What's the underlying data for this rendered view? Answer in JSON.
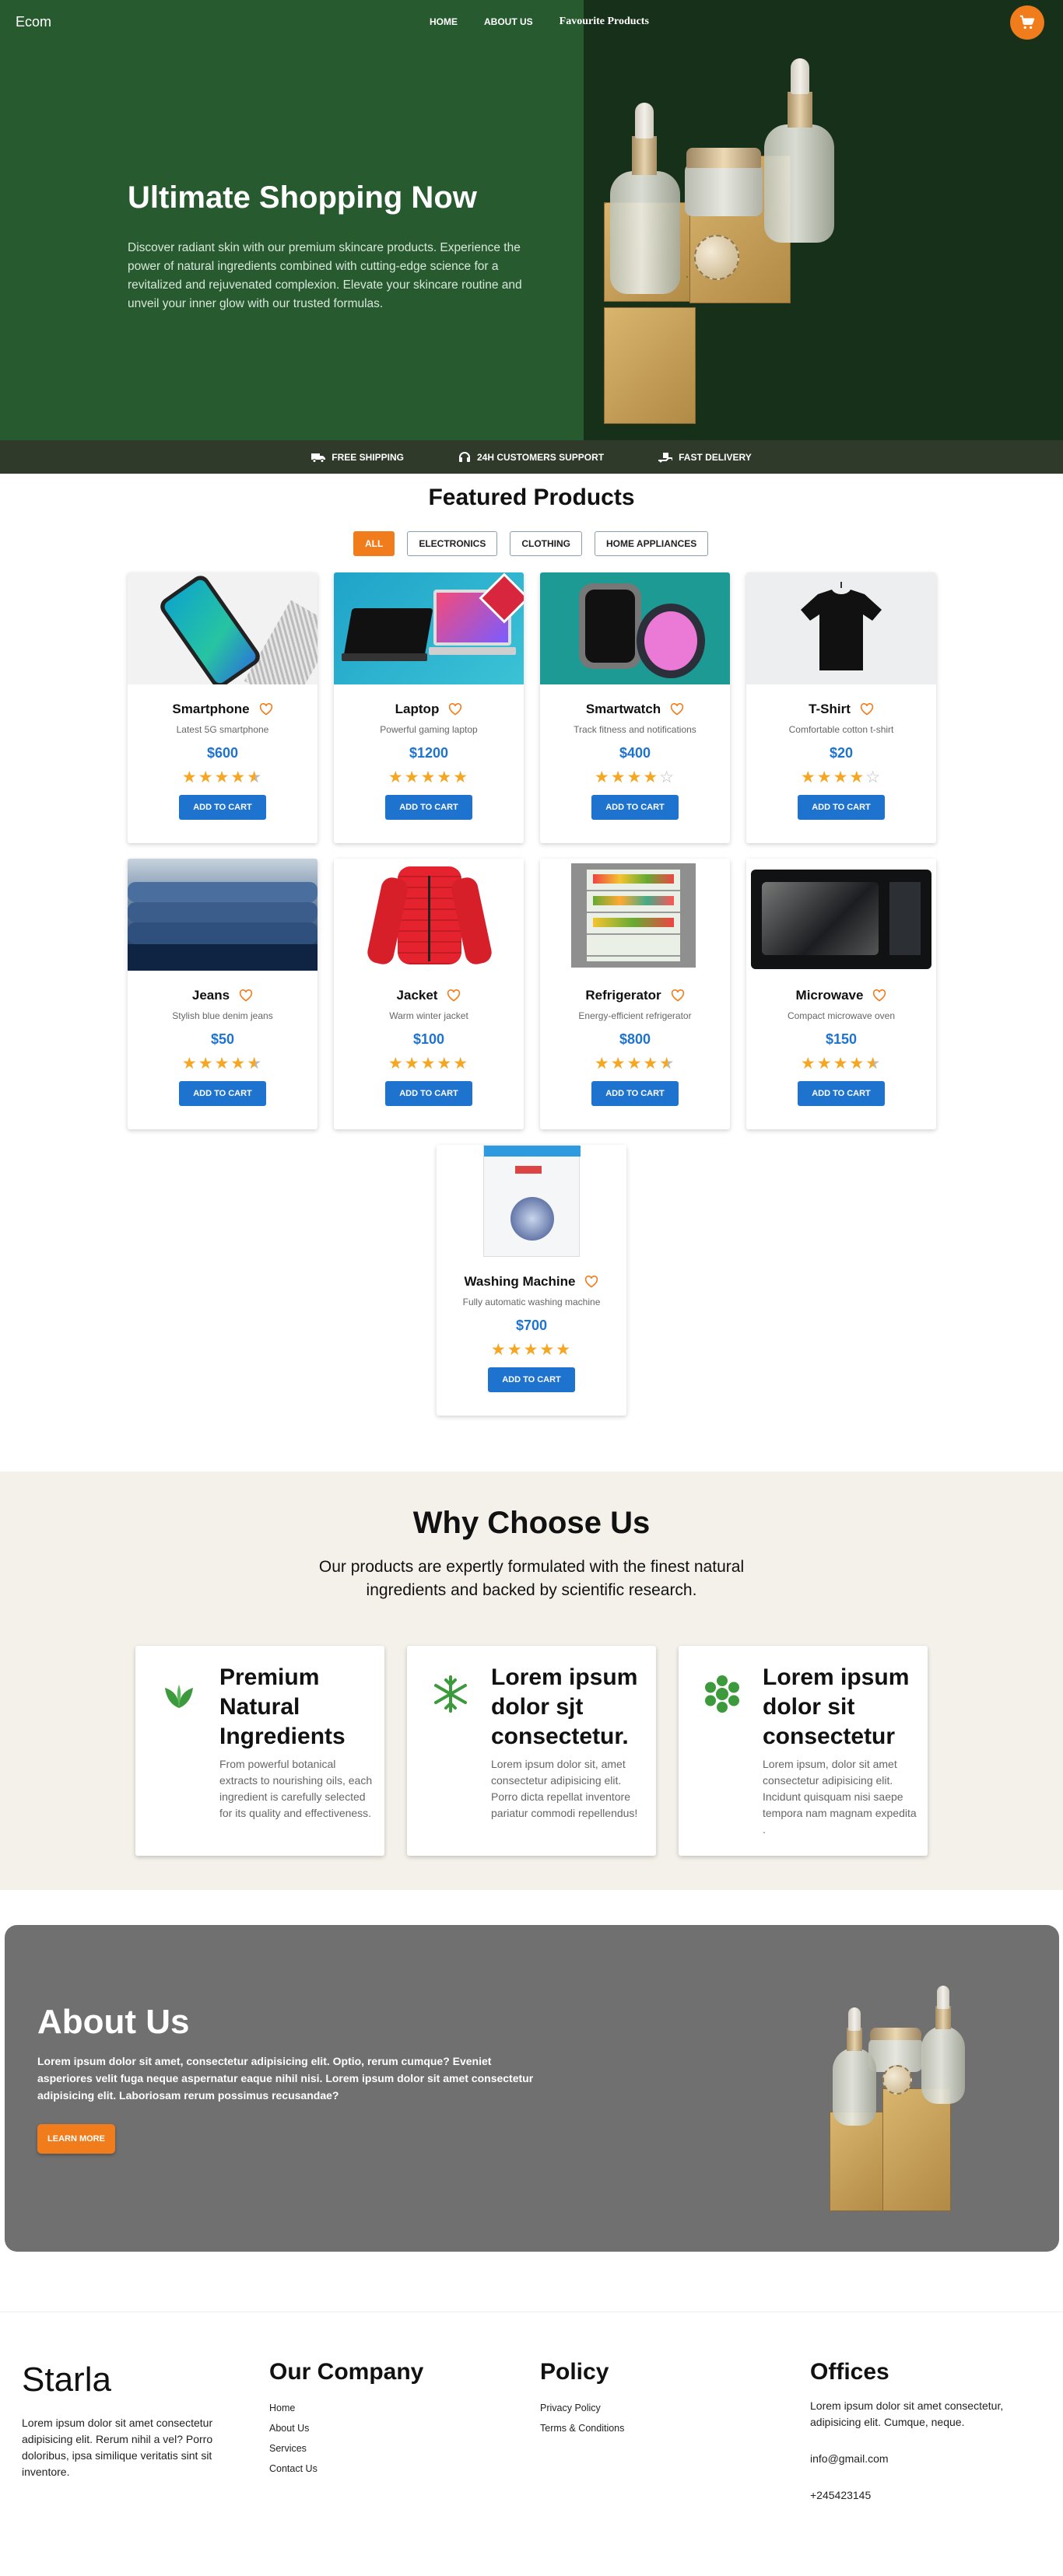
{
  "nav": {
    "brand": "Ecom",
    "links": [
      "HOME",
      "ABOUT US",
      "Favourite Products"
    ]
  },
  "hero": {
    "title": "Ultimate Shopping Now",
    "description": "Discover radiant skin with our premium skincare products. Experience the power of natural ingredients combined with cutting-edge science for a revitalized and rejuvenated complexion. Elevate your skincare routine and unveil your inner glow with our trusted formulas."
  },
  "features": [
    {
      "label": "FREE SHIPPING",
      "icon": "truck-icon"
    },
    {
      "label": "24H CUSTOMERS SUPPORT",
      "icon": "headset-icon"
    },
    {
      "label": "FAST DELIVERY",
      "icon": "delivery-icon"
    }
  ],
  "featured": {
    "title": "Featured Products",
    "filters": [
      "ALL",
      "ELECTRONICS",
      "CLOTHING",
      "HOME APPLIANCES"
    ],
    "active_filter": "ALL",
    "add_label": "ADD TO CART",
    "products": [
      {
        "name": "Smartphone",
        "desc": "Latest 5G smartphone",
        "price": "$600",
        "rating": 4.5
      },
      {
        "name": "Laptop",
        "desc": "Powerful gaming laptop",
        "price": "$1200",
        "rating": 5
      },
      {
        "name": "Smartwatch",
        "desc": "Track fitness and notifications",
        "price": "$400",
        "rating": 4
      },
      {
        "name": "T-Shirt",
        "desc": "Comfortable cotton t-shirt",
        "price": "$20",
        "rating": 4
      },
      {
        "name": "Jeans",
        "desc": "Stylish blue denim jeans",
        "price": "$50",
        "rating": 4.5
      },
      {
        "name": "Jacket",
        "desc": "Warm winter jacket",
        "price": "$100",
        "rating": 5
      },
      {
        "name": "Refrigerator",
        "desc": "Energy-efficient refrigerator",
        "price": "$800",
        "rating": 4.5
      },
      {
        "name": "Microwave",
        "desc": "Compact microwave oven",
        "price": "$150",
        "rating": 4.5
      },
      {
        "name": "Washing Machine",
        "desc": "Fully automatic washing machine",
        "price": "$700",
        "rating": 5
      }
    ]
  },
  "why": {
    "title": "Why Choose Us",
    "subtitle": "Our products are expertly formulated with the finest natural ingredients and backed by scientific research.",
    "cards": [
      {
        "title": "Premium Natural Ingredients",
        "text": "From powerful botanical extracts to nourishing oils, each ingredient is carefully selected for its quality and effectiveness.",
        "icon": "leaf-icon"
      },
      {
        "title": "Lorem ipsum dolor sjt consectetur.",
        "text": "Lorem ipsum dolor sit, amet consectetur adipisicing elit. Porro dicta repellat inventore pariatur commodi repellendus!",
        "icon": "snowflake-icon"
      },
      {
        "title": "Lorem ipsum dolor sit consectetur",
        "text": "Lorem ipsum, dolor sit amet consectetur adipisicing elit. Incidunt quisquam nisi saepe tempora nam magnam expedita .",
        "icon": "hexagon-cluster-icon"
      }
    ]
  },
  "about": {
    "title": "About Us",
    "text": "Lorem ipsum dolor sit amet, consectetur adipisicing elit. Optio, rerum cumque? Eveniet asperiores velit fuga neque aspernatur eaque nihil nisi. Lorem ipsum dolor sit amet consectetur adipisicing elit. Laboriosam rerum possimus recusandae?",
    "button": "LEARN MORE"
  },
  "footer": {
    "brand": "Starla",
    "description": "Lorem ipsum dolor sit amet consectetur adipisicing elit. Rerum nihil a vel? Porro doloribus, ipsa similique veritatis sint sit inventore.",
    "company": {
      "title": "Our Company",
      "links": [
        "Home",
        "About Us",
        "Services",
        "Contact Us"
      ]
    },
    "policy": {
      "title": "Policy",
      "links": [
        "Privacy Policy",
        "Terms & Conditions"
      ]
    },
    "offices": {
      "title": "Offices",
      "address": "Lorem ipsum dolor sit amet consectetur, adipisicing elit. Cumque, neque.",
      "email": "info@gmail.com",
      "phone": "+245423145"
    }
  },
  "colors": {
    "accent": "#f07c1c",
    "primary": "#1e73cf",
    "hero_green": "#275a2f",
    "star": "#f5a623"
  }
}
